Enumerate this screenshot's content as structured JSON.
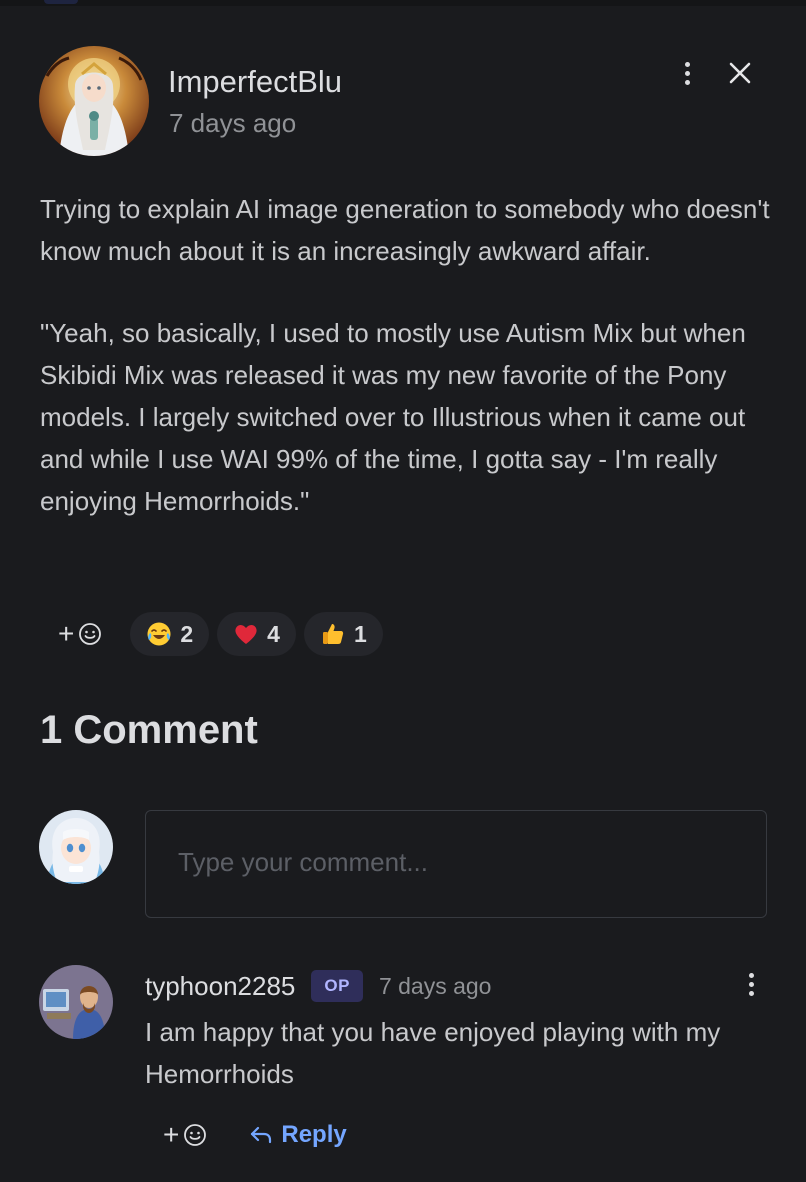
{
  "post": {
    "author": "ImperfectBlu",
    "time": "7 days ago",
    "paragraphs": [
      "Trying to explain AI image generation to somebody who doesn't know much about it is an increasingly awkward affair.",
      "\"Yeah, so basically, I used to mostly use Autism Mix but when Skibidi Mix was released it was my new favorite of the Pony models. I largely switched over to Illustrious when it came out and while I use WAI 99% of the time, I gotta say - I'm really enjoying Hemorrhoids.\""
    ],
    "add_reaction_label": "+",
    "reactions": [
      {
        "icon": "laughing-tears-emoji-icon",
        "count": "2"
      },
      {
        "icon": "red-heart-emoji-icon",
        "count": "4"
      },
      {
        "icon": "thumbs-up-emoji-icon",
        "count": "1"
      }
    ]
  },
  "comments": {
    "heading": "1 Comment",
    "input_placeholder": "Type your comment...",
    "items": [
      {
        "author": "typhoon2285",
        "badge": "OP",
        "time": "7 days ago",
        "text": "I am happy that you have enjoyed playing with my Hemorrhoids",
        "add_reaction_label": "+",
        "reply_label": "Reply"
      }
    ]
  },
  "icons": {
    "post_menu": "kebab-menu-icon",
    "close": "close-icon",
    "add_emoji": "smiley-face-icon",
    "reply": "reply-arrow-icon"
  },
  "colors": {
    "background": "#1a1b1e",
    "reaction_pill": "#25262b",
    "op_badge_bg": "#2f2e5a",
    "op_badge_text": "#b1b5ff",
    "reply_link": "#74a6ff",
    "input_border": "#373a40"
  }
}
